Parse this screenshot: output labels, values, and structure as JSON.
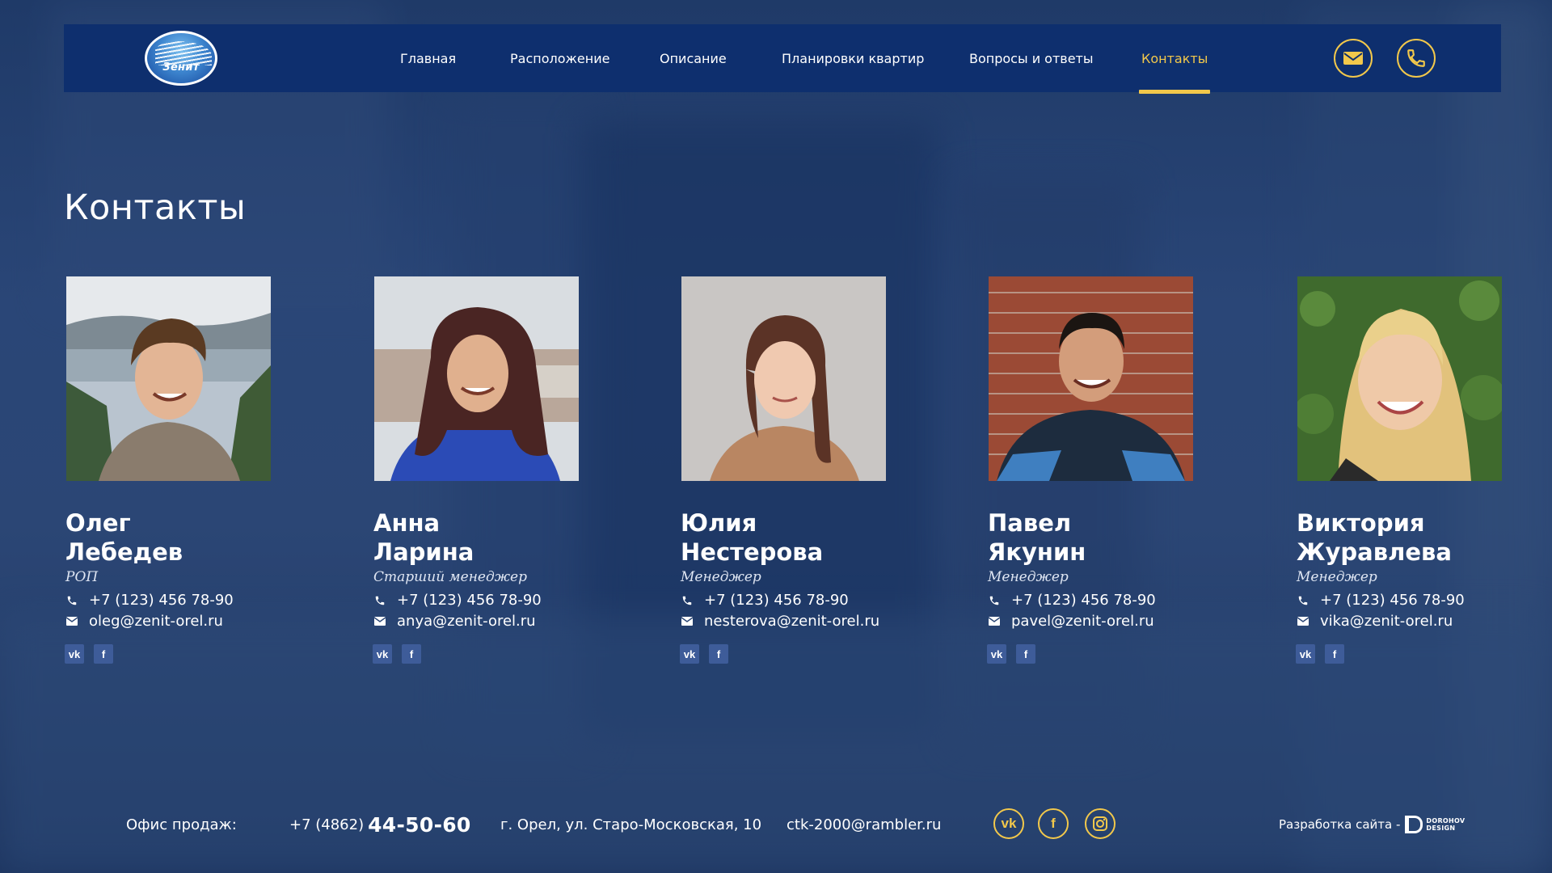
{
  "header": {
    "logo_text": "Зенит",
    "nav": [
      {
        "label": "Главная",
        "active": false
      },
      {
        "label": "Расположение",
        "active": false
      },
      {
        "label": "Описание",
        "active": false
      },
      {
        "label": "Планировки квартир",
        "active": false
      },
      {
        "label": "Вопросы и ответы",
        "active": false
      },
      {
        "label": "Контакты",
        "active": true
      }
    ],
    "buttons": {
      "mail_icon": "mail-icon",
      "phone_icon": "phone-icon"
    }
  },
  "page_title": "Контакты",
  "contacts": [
    {
      "first": "Олег",
      "last": "Лебедев",
      "role": "РОП",
      "phone": "+7 (123) 456 78-90",
      "email": "oleg@zenit-orel.ru"
    },
    {
      "first": "Анна",
      "last": "Ларина",
      "role": "Старший менеджер",
      "phone": "+7 (123) 456 78-90",
      "email": "anya@zenit-orel.ru"
    },
    {
      "first": "Юлия",
      "last": "Нестерова",
      "role": "Менеджер",
      "phone": "+7 (123) 456 78-90",
      "email": "nesterova@zenit-orel.ru"
    },
    {
      "first": "Павел",
      "last": "Якунин",
      "role": "Менеджер",
      "phone": "+7 (123) 456 78-90",
      "email": "pavel@zenit-orel.ru"
    },
    {
      "first": "Виктория",
      "last": "Журавлева",
      "role": "Менеджер",
      "phone": "+7 (123) 456 78-90",
      "email": "vika@zenit-orel.ru"
    }
  ],
  "footer": {
    "office_label": "Офис продаж:",
    "phone_code": "+7 (4862)",
    "phone_number": "44-50-60",
    "address": "г. Орел, ул. Старо-Московская, 10",
    "email": "ctk-2000@rambler.ru",
    "dev_label": "Разработка сайта -",
    "dev_logo_line1": "DOROHOV",
    "dev_logo_line2": "DESIGN"
  },
  "colors": {
    "accent": "#f2c84b",
    "header_bg": "#0e2f6e",
    "social_bg": "#3e5c99"
  }
}
